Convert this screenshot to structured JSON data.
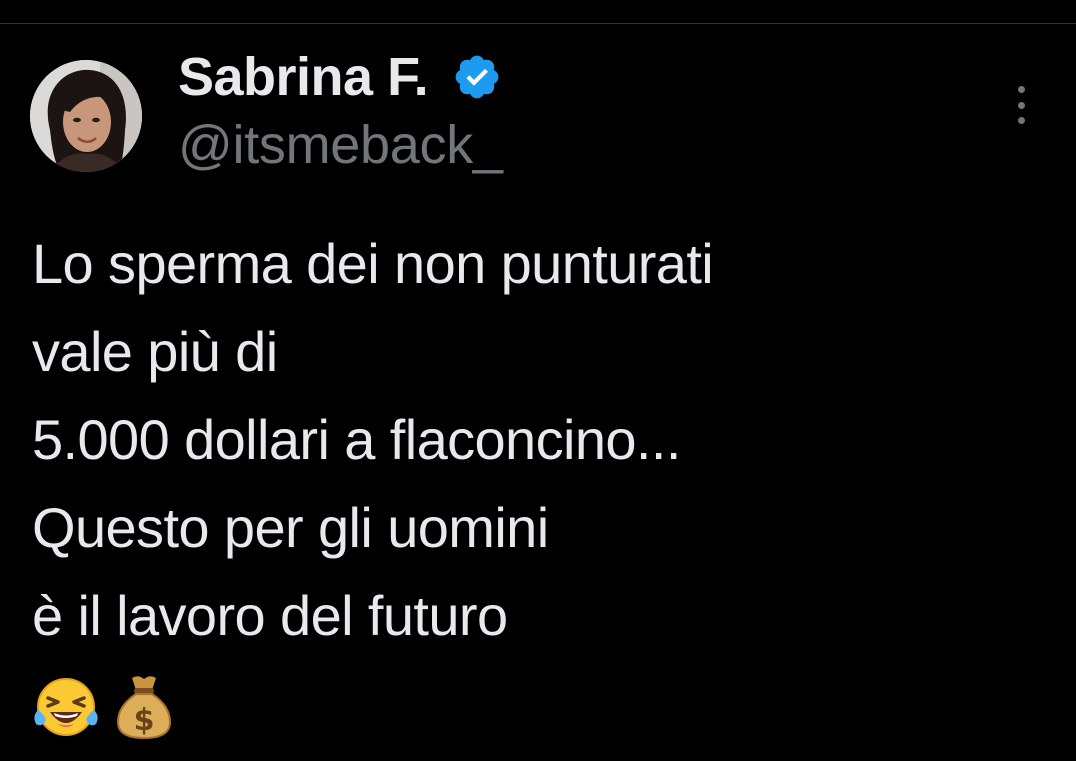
{
  "tweet": {
    "author": {
      "display_name": "Sabrina F.",
      "handle": "@itsmeback_",
      "verified": true,
      "verified_color": "#1d9bf0",
      "avatar_icon": "profile-photo"
    },
    "text_lines": [
      "Lo sperma dei non punturati",
      "vale più di",
      "5.000 dollari a flaconcino...",
      "Questo per gli uomini",
      "è il lavoro del futuro"
    ],
    "emojis": [
      {
        "name": "face-with-tears-of-joy-icon",
        "glyph": "😂"
      },
      {
        "name": "money-bag-icon",
        "glyph": "💰"
      }
    ],
    "more_icon": "more-options-icon"
  },
  "colors": {
    "background": "#000000",
    "primary_text": "#e7e9ea",
    "secondary_text": "#71767b",
    "divider": "#2f3336"
  }
}
